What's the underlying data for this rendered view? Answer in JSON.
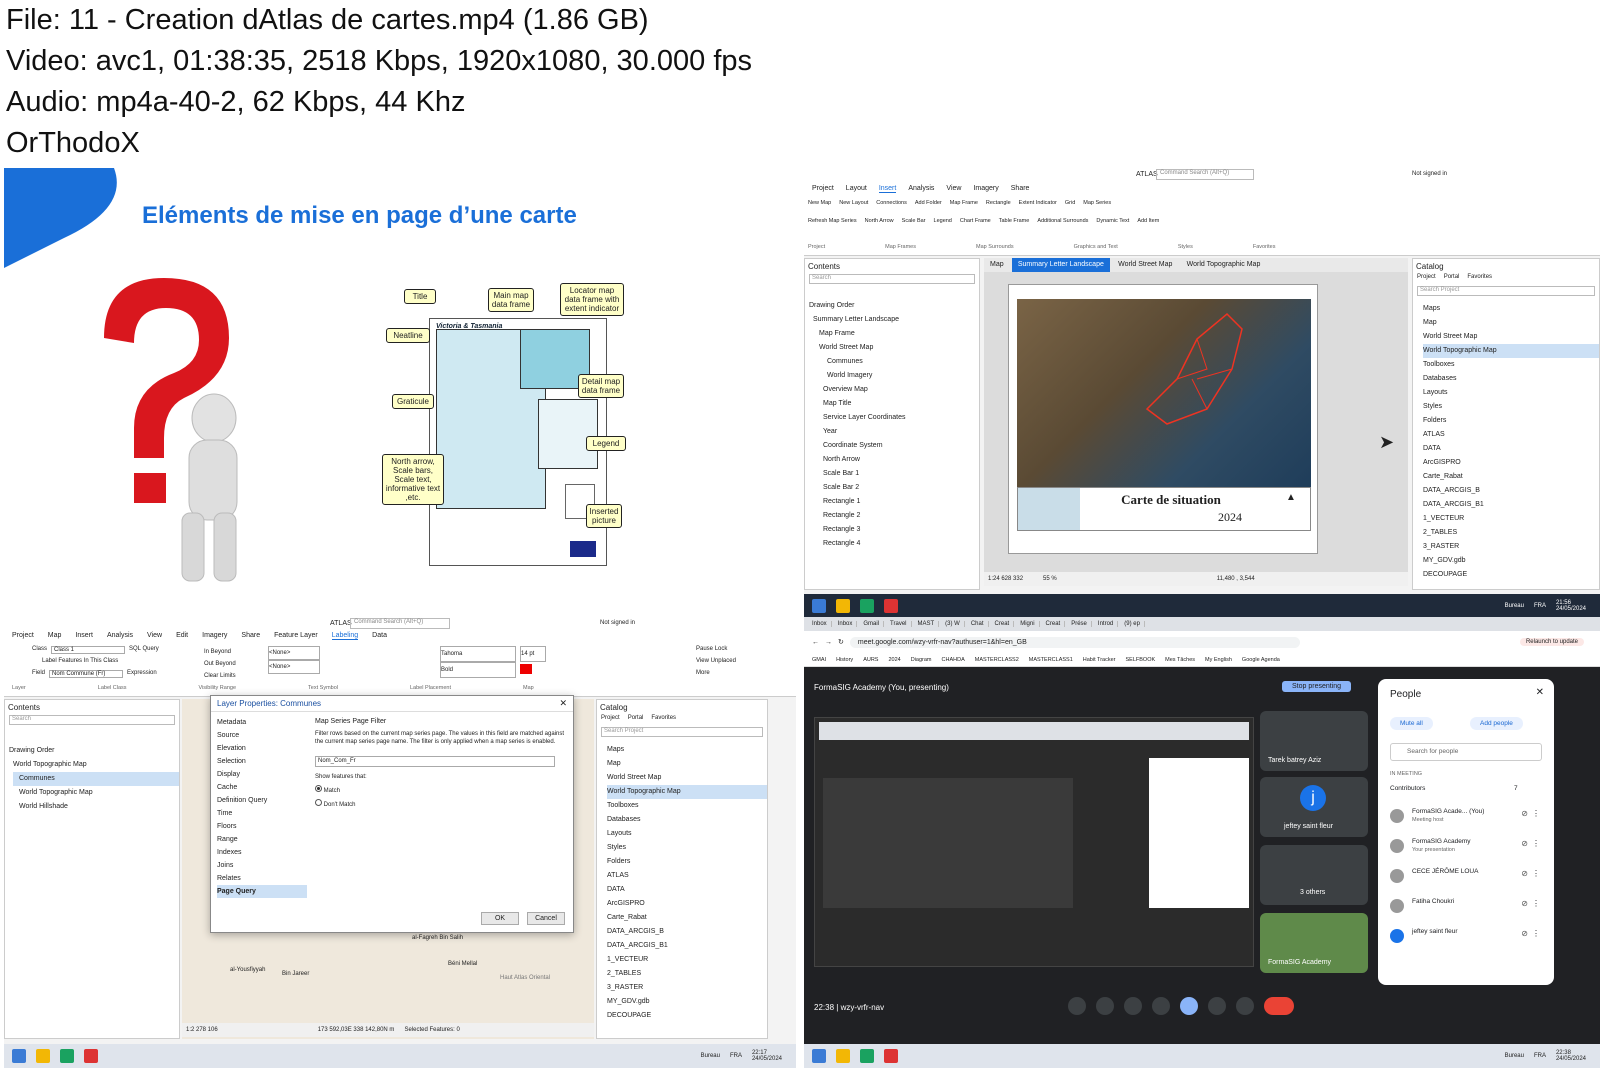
{
  "header": {
    "line1": "File: 11 - Creation dAtlas de cartes.mp4 (1.86 GB)",
    "line2": "Video: avc1, 01:38:35, 2518 Kbps, 1920x1080, 30.000 fps",
    "line3": "Audio: mp4a-40-2, 62 Kbps, 44 Khz",
    "line4": "OrThodoX"
  },
  "slide": {
    "title": "Eléments de mise en page d’une carte",
    "map_title": "Victoria & Tasmania",
    "callouts": {
      "title": "Title",
      "neatline": "Neatline",
      "main": "Main map data frame",
      "locator": "Locator map data frame with extent indicator",
      "detail": "Detail map data frame",
      "graticule": "Graticule",
      "legend": "Legend",
      "north": "North arrow, Scale bars, Scale text, informative text ,etc.",
      "inserted": "Inserted picture"
    }
  },
  "arcgis_top": {
    "app": "ATLAS",
    "search": "Command Search (Alt+Q)",
    "signed": "Not signed in",
    "tabs": [
      "Project",
      "Layout",
      "Insert",
      "Analysis",
      "View",
      "Imagery",
      "Share"
    ],
    "ribbon": [
      "New Map",
      "New Layout",
      "Connections",
      "Add Folder",
      "Map Frame",
      "Rectangle",
      "Extent Indicator",
      "Grid",
      "Map Series",
      "Refresh Map Series",
      "North Arrow",
      "Scale Bar",
      "Legend",
      "Chart Frame",
      "Table Frame",
      "Additional Surrounds",
      "Dynamic Text",
      "Add Item"
    ],
    "groups": [
      "Project",
      "Map Frames",
      "Map Surrounds",
      "Graphics and Text",
      "Styles",
      "Favorites"
    ],
    "doc_tabs": [
      "Map",
      "Summary Letter Landscape",
      "World Street Map",
      "World Topographic Map"
    ],
    "contents_title": "Contents",
    "search_ph": "Search",
    "drawing_order": "Drawing Order",
    "layers": [
      "Summary Letter Landscape",
      "Map Frame",
      "World Street Map",
      "Communes",
      "World Imagery",
      "Overview Map",
      "Map Title",
      "Service Layer Coordinates",
      "Year",
      "Coordinate System",
      "North Arrow",
      "Scale Bar 1",
      "Scale Bar 2",
      "Rectangle 1",
      "Rectangle 2",
      "Rectangle 3",
      "Rectangle 4"
    ],
    "layout_title": "Carte de situation",
    "layout_year": "2024",
    "status_scale": "1:24 628 332",
    "status_zoom": "55 %",
    "status_coords": "11,480 , 3,544",
    "catalog_title": "Catalog",
    "catalog_tabs": [
      "Project",
      "Portal",
      "Favorites"
    ],
    "catalog_search": "Search Project",
    "catalog_items": [
      "Maps",
      "Map",
      "World Street Map",
      "World Topographic Map",
      "Toolboxes",
      "Databases",
      "Layouts",
      "Styles",
      "Folders",
      "ATLAS",
      "DATA",
      "ArcGISPRO",
      "Carte_Rabat",
      "DATA_ARCGIS_B",
      "DATA_ARCGIS_B1",
      "1_VECTEUR",
      "2_TABLES",
      "3_RASTER",
      "MY_GDV.gdb",
      "DECOUPAGE"
    ],
    "clock_time": "21:56",
    "clock_date": "24/05/2024",
    "lang": "FRA",
    "bureau": "Bureau"
  },
  "arcgis_bottom": {
    "app": "ATLAS",
    "search": "Command Search (Alt+Q)",
    "signed": "Not signed in",
    "tabs": [
      "Project",
      "Map",
      "Insert",
      "Analysis",
      "View",
      "Edit",
      "Imagery",
      "Share",
      "Feature Layer",
      "Labeling",
      "Data"
    ],
    "class_label": "Class",
    "class_value": "Class 1",
    "sql": "SQL Query",
    "label_features": "Label Features In This Class",
    "field_label": "Field",
    "field_value": "Nom Commune (Fr)",
    "expression": "Expression",
    "in_beyond": "In Beyond",
    "out_beyond": "Out Beyond",
    "clear_limits": "Clear Limits",
    "none1": "<None>",
    "none2": "<None>",
    "font": "Tahoma",
    "size": "14 pt",
    "weight": "Bold",
    "pause": "Pause",
    "lock": "Lock",
    "view_unplaced": "View Unplaced",
    "more": "More",
    "groups": [
      "Layer",
      "Label Class",
      "Visibility Range",
      "Text Symbol",
      "Label Placement",
      "Map"
    ],
    "contents_title": "Contents",
    "search_ph": "Search",
    "drawing_order": "Drawing Order",
    "layers": [
      "World Topographic Map",
      "Communes",
      "World Topographic Map",
      "World Hillshade"
    ],
    "dialog_title": "Layer Properties: Communes",
    "dialog_menu": [
      "Metadata",
      "Source",
      "Elevation",
      "Selection",
      "Display",
      "Cache",
      "Definition Query",
      "Time",
      "Floors",
      "Range",
      "Indexes",
      "Joins",
      "Relates",
      "Page Query"
    ],
    "filter_title": "Map Series Page Filter",
    "filter_desc": "Filter rows based on the current map series page. The values in this field are matched against the current map series page name. The filter is only applied when a map series is enabled.",
    "filter_field": "Nom_Com_Fr",
    "show_features": "Show features that:",
    "match": "Match",
    "dont_match": "Don't Match",
    "ok": "OK",
    "cancel": "Cancel",
    "catalog_title": "Catalog",
    "catalog_tabs": [
      "Project",
      "Portal",
      "Favorites"
    ],
    "catalog_search": "Search Project",
    "catalog_items": [
      "Maps",
      "Map",
      "World Street Map",
      "World Topographic Map",
      "Toolboxes",
      "Databases",
      "Layouts",
      "Styles",
      "Folders",
      "ATLAS",
      "DATA",
      "ArcGISPRO",
      "Carte_Rabat",
      "DATA_ARCGIS_B",
      "DATA_ARCGIS_B1",
      "1_VECTEUR",
      "2_TABLES",
      "3_RASTER",
      "MY_GDV.gdb",
      "DECOUPAGE"
    ],
    "place1": "al-Fagreh Bin Salih",
    "place2": "Béni Mellal",
    "place3": "al-Yousfiyyah",
    "place4": "Bin Jareer",
    "place5": "Haut Atlas Oriental",
    "status_scale": "1:2 278 106",
    "status_coords": "173 592,03E 338 142,80N m",
    "selected": "Selected Features: 0",
    "clock_time": "22:17",
    "clock_date": "24/05/2024",
    "lang": "FRA",
    "bureau": "Bureau"
  },
  "meet": {
    "tabs": [
      "Inbox",
      "Inbox",
      "Gmail",
      "Travel",
      "MAST",
      "(3) W",
      "Chat",
      "Creat",
      "Migni",
      "Creat",
      "Prése",
      "Introd",
      "(9) ep"
    ],
    "url": "meet.google.com/wzy-vrfr-nav?authuser=1&hl=en_GB",
    "relaunch": "Relaunch to update",
    "bookmarks": [
      "GMAI",
      "History",
      "AURS",
      "2024",
      "Diagram",
      "CHAHDA",
      "MASTERCLASS2",
      "MASTERCLASS1",
      "Habit Tracker",
      "SELFBOOK",
      "Mes Tâches",
      "My English",
      "Google Agenda"
    ],
    "presenting": "FormaSIG Academy (You, presenting)",
    "stop": "Stop presenting",
    "tiles": [
      "Tarek batrey Aziz",
      "jeftey saint fleur",
      "3 others",
      "FormaSIG Academy"
    ],
    "people_title": "People",
    "mute_all": "Mute all",
    "add_people": "Add people",
    "search_people": "Search for people",
    "in_meeting": "IN MEETING",
    "contributors": "Contributors",
    "contrib_count": "7",
    "participants": [
      {
        "name": "FormaSIG Acade... (You)",
        "sub": "Meeting host"
      },
      {
        "name": "FormaSIG Academy",
        "sub": "Your presentation"
      },
      {
        "name": "CECE JÉRÔME LOUA",
        "sub": ""
      },
      {
        "name": "Fatiha Choukri",
        "sub": ""
      },
      {
        "name": "jeftey saint fleur",
        "sub": ""
      }
    ],
    "time": "22:38",
    "code": "wzy-vrfr-nav",
    "clock_time": "22:38",
    "clock_date": "24/05/2024",
    "lang": "FRA",
    "bureau": "Bureau"
  }
}
